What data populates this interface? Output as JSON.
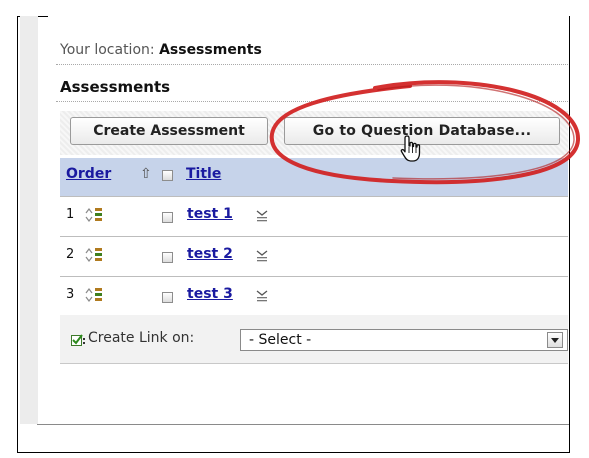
{
  "breadcrumb": {
    "prefix": "Your location:",
    "current": "Assessments"
  },
  "page": {
    "title": "Assessments"
  },
  "toolbar": {
    "create_label": "Create Assessment",
    "question_db_label": "Go to Question Database..."
  },
  "table": {
    "header": {
      "order": "Order",
      "title": "Title"
    },
    "rows": [
      {
        "order": "1",
        "title": "test 1"
      },
      {
        "order": "2",
        "title": "test 2"
      },
      {
        "order": "3",
        "title": "test 3"
      }
    ]
  },
  "footer": {
    "create_link_label": "Create Link on:",
    "select_value": "- Select -"
  },
  "icons": {
    "sort": "sort-up-arrow-icon",
    "reorder": "reorder-icon",
    "menu": "context-menu-icon",
    "link": "create-link-icon",
    "cursor": "hand-pointer-icon"
  },
  "colors": {
    "link": "#1a1aa0",
    "header_bg": "#c6d3ea",
    "annotation": "#d01f1f"
  }
}
